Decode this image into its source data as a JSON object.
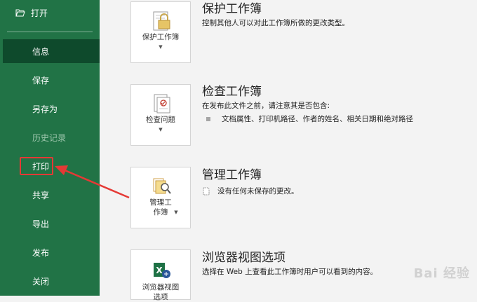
{
  "sidebar": {
    "open_label": "打开",
    "items": [
      {
        "label": "信息"
      },
      {
        "label": "保存"
      },
      {
        "label": "另存为"
      },
      {
        "label": "历史记录"
      },
      {
        "label": "打印"
      },
      {
        "label": "共享"
      },
      {
        "label": "导出"
      },
      {
        "label": "发布"
      },
      {
        "label": "关闭"
      }
    ]
  },
  "main": {
    "protect": {
      "tile_label": "保护工作簿",
      "title": "保护工作簿",
      "desc": "控制其他人可以对此工作簿所做的更改类型。"
    },
    "inspect": {
      "tile_label": "检查问题",
      "title": "检查工作簿",
      "desc": "在发布此文件之前，请注意其是否包含:",
      "bullet": "文档属性、打印机路径、作者的姓名、相关日期和绝对路径"
    },
    "manage": {
      "tile_label_line1": "管理工",
      "tile_label_line2": "作簿",
      "title": "管理工作簿",
      "doc_note": "没有任何未保存的更改。"
    },
    "browser": {
      "tile_label_line1": "浏览器视图",
      "tile_label_line2": "选项",
      "title": "浏览器视图选项",
      "desc": "选择在 Web 上查看此工作簿时用户可以看到的内容。"
    }
  },
  "watermark": "Bai 经验",
  "colors": {
    "sidebar": "#217346",
    "sidebar_active": "#0e4a2c",
    "highlight": "#e53935"
  }
}
